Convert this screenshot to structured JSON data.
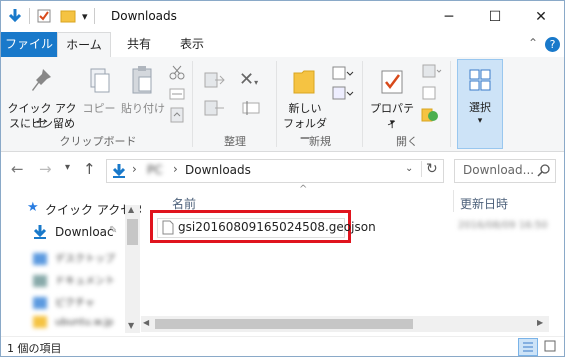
{
  "window": {
    "title": "Downloads",
    "minimize_glyph": "─",
    "maximize_glyph": "☐",
    "close_glyph": "✕",
    "dropdown_glyph": "▾"
  },
  "ribbon_tabs": {
    "file": "ファイル",
    "home": "ホーム",
    "share": "共有",
    "view": "表示",
    "help_glyph": "?",
    "collapse_glyph": "⌃"
  },
  "ribbon": {
    "pin_quick_access": "クイック アクセスにピン留め",
    "pin_line1": "クイック アクセ",
    "pin_line2": "スにピン留め",
    "copy": "コピー",
    "paste": "貼り付け",
    "clipboard_group": "クリップボード",
    "organize_group": "整理",
    "new_folder_line1": "新しい",
    "new_folder_line2": "フォルダー",
    "new_group": "新規",
    "properties": "プロパティ",
    "open_group": "開く",
    "select": "選択"
  },
  "address": {
    "back_glyph": "←",
    "forward_glyph": "→",
    "up_glyph": "↑",
    "recent_glyph": "▾",
    "pc_label": "PC",
    "separator": "›",
    "current": "Downloads",
    "search_placeholder": "Download..."
  },
  "nav_pane": {
    "quick_access": "クイック アクセス",
    "downloads": "Downloac",
    "blurred_items": [
      "デスクトップ",
      "ドキュメント",
      "ピクチャ",
      "ubuntu.w.jp"
    ]
  },
  "content": {
    "col_name": "名前",
    "col_date": "更新日時",
    "sort_glyph": "^",
    "files": [
      {
        "name": "gsi20160809165024508.geojson",
        "date": "2016/08/09 16:50"
      }
    ],
    "highlight_color": "#e0141e"
  },
  "status": {
    "item_count": "1 個の項目"
  },
  "colors": {
    "accent": "#1979ca",
    "folder": "#f5c342"
  }
}
